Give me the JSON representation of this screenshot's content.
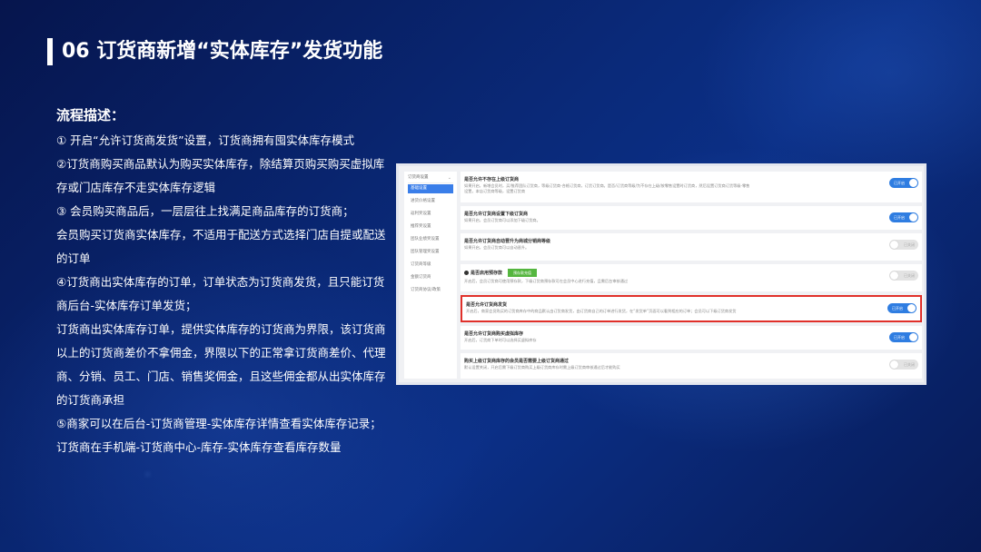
{
  "title": "06 订货商新增“实体库存”发货功能",
  "description": {
    "heading": "流程描述：",
    "lines": [
      "① 开启“允许订货商发货”设置，订货商拥有囤实体库存模式",
      "②订货商购买商品默认为购买实体库存，除结算页购买购买虚拟库",
      "存或门店库存不走实体库存逻辑",
      "③ 会员购买商品后，一层层往上找满足商品库存的订货商；",
      "会员购买订货商实体库存，不适用于配送方式选择门店自提或配送",
      "的订单",
      "④订货商出实体库存的订单，订单状态为订货商发货，且只能订货",
      "商后台-实体库存订单发货；",
      "订货商出实体库存订单，提供实体库存的订货商为界限，该订货商",
      "以上的订货商差价不拿佣金，界限以下的正常拿订货商差价、代理",
      "商、分销、员工、门店、销售奖佣金，且这些佣金都从出实体库存",
      "的订货商承担",
      "⑤商家可以在后台-订货商管理-实体库存详情查看实体库存记录；",
      "订货商在手机端-订货商中心-库存-实体库存查看库存数量"
    ]
  },
  "screenshot": {
    "sidebar": {
      "header": "订货商设置",
      "items": [
        {
          "label": "基础设置",
          "active": true
        },
        {
          "label": "进货价格设置",
          "active": false
        },
        {
          "label": "返利奖设置",
          "active": false
        },
        {
          "label": "推荐奖设置",
          "active": false
        },
        {
          "label": "团队业绩奖设置",
          "active": false
        },
        {
          "label": "团队管理奖设置",
          "active": false
        },
        {
          "label": "订货商等级",
          "active": false
        },
        {
          "label": "金额订货商",
          "active": false
        },
        {
          "label": "订货商协议/政策",
          "active": false
        }
      ]
    },
    "rows": [
      {
        "title": "是否允许不存在上级订货商",
        "desc": [
          "如果开启，新增会员时，买/推荐团队订货商，等级订货商-合格订货商，订货订货商。是否/订货商等级/为不存在上级/按零售设置时订货商，然后设置订货商订货等级-零售",
          "设置，本店订货商等级，设置订货商"
        ],
        "toggle": "on",
        "toggle_label": "已开启"
      },
      {
        "title": "是否允许订货商设置下级订货商",
        "desc": [
          "如果开启，会员订货商可以添加下级订货商。"
        ],
        "toggle": "on",
        "toggle_label": "已开启"
      },
      {
        "title": "是否允许订货商自动晋升为商城分销商等级",
        "desc": [
          "如果开启，会员订货商可以自动晋升。"
        ],
        "toggle": "off",
        "toggle_label": "已关闭"
      },
      {
        "title": "是否启用预存款",
        "tag": "预存款充值",
        "desc": [
          "开启后，会员订货商可使用预存款，下级订货商预存款可在会员中心进行充值，且需后台审核通过"
        ],
        "toggle": "off",
        "toggle_label": "已关闭"
      },
      {
        "title": "是否允许订货商发货",
        "desc": [
          "开启后，商家会员购买的订货商库存中的商品默认由订货商发货，由订货商自己的订单进行发货，在“发货单”页面可以看到相应的订单；会员可以下级订货商发货"
        ],
        "toggle": "on",
        "toggle_label": "已开启",
        "highlight": true
      },
      {
        "title": "是否允许订货商购买虚拟库存",
        "desc": [
          "开启后，订货商下单时可以选择买虚拟库存"
        ],
        "toggle": "on",
        "toggle_label": "已开启"
      },
      {
        "title": "购买上级订货商库存的会员是否需要上级订货商通过",
        "desc": [
          "默认设置关闭，开启后需下级订货商购买上级订货商库存时需上级订货商审核通过后才能购买"
        ],
        "toggle": "off",
        "toggle_label": "已关闭"
      }
    ]
  }
}
